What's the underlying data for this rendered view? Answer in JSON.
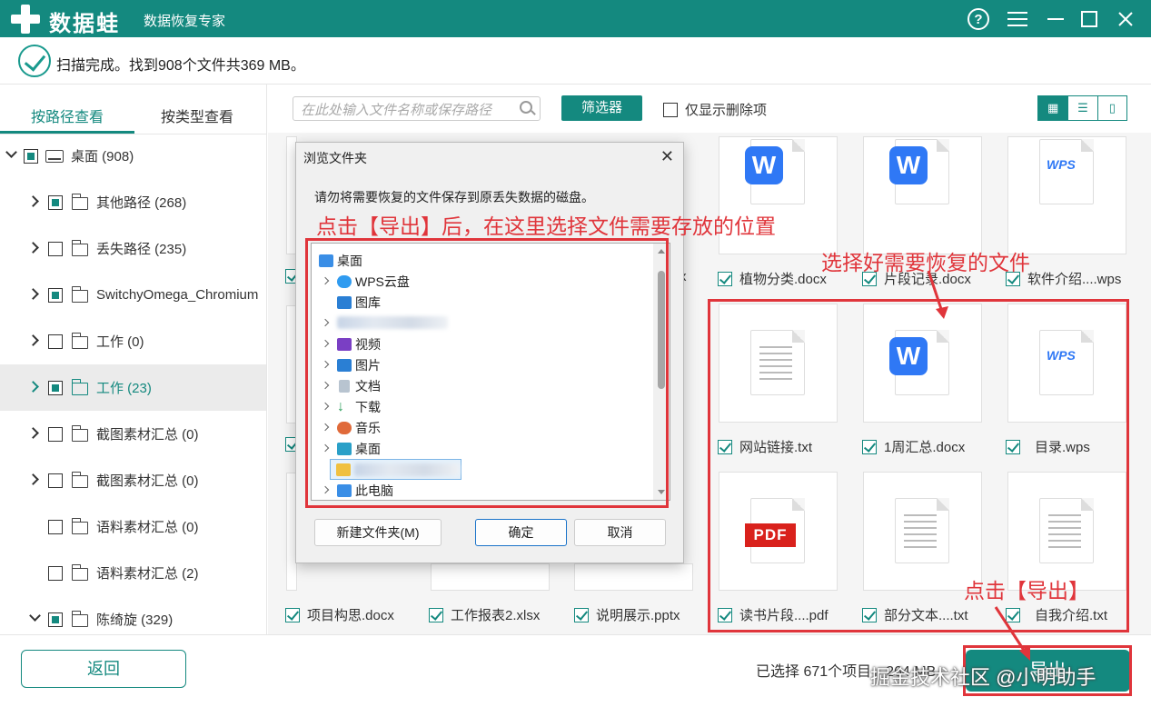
{
  "titlebar": {
    "brand": "数据蛙",
    "app_title": "数据恢复专家"
  },
  "status": {
    "message": "扫描完成。找到908个文件共369 MB。"
  },
  "tabs": [
    "按路径查看",
    "按类型查看"
  ],
  "tree": [
    {
      "label": "桌面 (908)"
    },
    {
      "label": "其他路径 (268)"
    },
    {
      "label": "丢失路径 (235)"
    },
    {
      "label": "SwitchyOmega_Chromium"
    },
    {
      "label": "工作 (0)"
    },
    {
      "label": "工作 (23)"
    },
    {
      "label": "截图素材汇总 (0)"
    },
    {
      "label": "截图素材汇总 (0)"
    },
    {
      "label": "语料素材汇总 (0)"
    },
    {
      "label": "语料素材汇总 (2)"
    },
    {
      "label": "陈绮旋 (329)"
    }
  ],
  "toolbar": {
    "search_placeholder": "在此处输入文件名称或保存路径",
    "filter_label": "筛选器",
    "only_deleted_label": "仅显示删除项"
  },
  "files": {
    "row1": [
      "植物分类.docx",
      "片段记录.docx",
      "软件介绍....wps"
    ],
    "row1_left_partial": "x",
    "row2": [
      "网站链接.txt",
      "1周汇总.docx",
      "目录.wps"
    ],
    "row3": [
      "项目构思.docx",
      "工作报表2.xlsx",
      "说明展示.pptx",
      "读书片段....pdf",
      "部分文本....txt",
      "自我介绍.txt"
    ],
    "wps_logo": "WPS",
    "pdf_logo": "PDF",
    "w_logo": "W"
  },
  "bottom": {
    "back_label": "返回",
    "selection_info": "已选择 671个项目，264 MB",
    "export_label": "导出"
  },
  "dialog": {
    "title": "浏览文件夹",
    "description": "请勿将需要恢复的文件保存到原丢失数据的磁盘。",
    "items": [
      "桌面",
      "WPS云盘",
      "图库",
      "",
      "视频",
      "图片",
      "文档",
      "下载",
      "音乐",
      "桌面",
      "",
      "此电脑"
    ],
    "new_folder_label": "新建文件夹(M)",
    "ok_label": "确定",
    "cancel_label": "取消"
  },
  "annotations": {
    "dialog_hint": "点击【导出】后，在这里选择文件需要存放的位置",
    "select_hint": "选择好需要恢复的文件",
    "export_hint": "点击【导出】"
  },
  "watermark": "掘金技术社区 @小明助手",
  "colors": {
    "brand": "#14897f",
    "annotation": "#e0353b",
    "word_blue": "#2f78f5",
    "pdf_red": "#d9211c"
  }
}
